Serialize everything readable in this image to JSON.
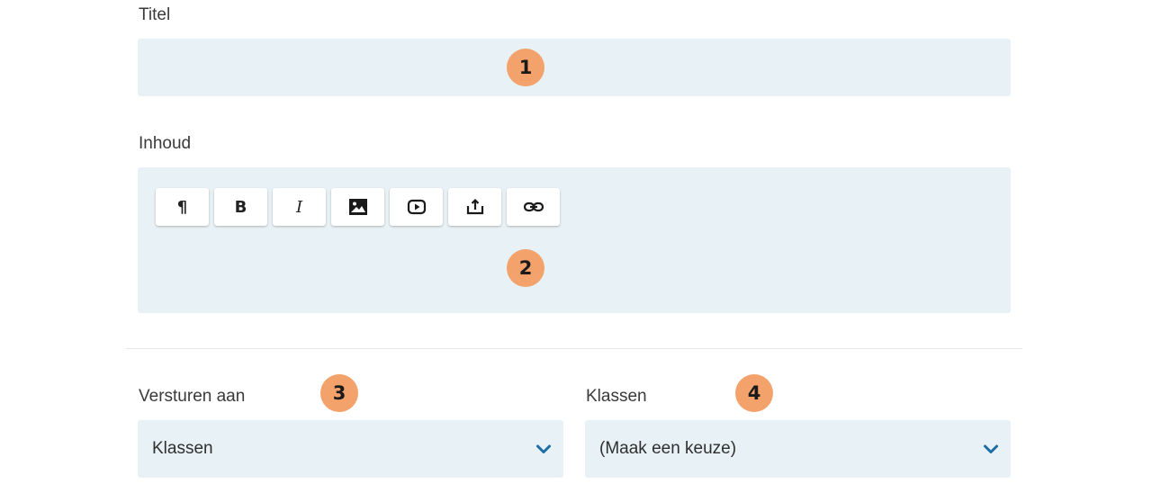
{
  "form": {
    "title_label": "Titel",
    "title_value": "",
    "content_label": "Inhoud",
    "send_to_label": "Versturen aan",
    "send_to_value": "Klassen",
    "classes_label": "Klassen",
    "classes_value": "(Maak een keuze)"
  },
  "toolbar": {
    "paragraph_glyph": "¶",
    "bold_glyph": "B",
    "italic_glyph": "I"
  },
  "markers": [
    "1",
    "2",
    "3",
    "4"
  ],
  "colors": {
    "field_bg": "#e8f1f5",
    "marker": "#f4a26b",
    "chevron": "#1c6ea4"
  }
}
